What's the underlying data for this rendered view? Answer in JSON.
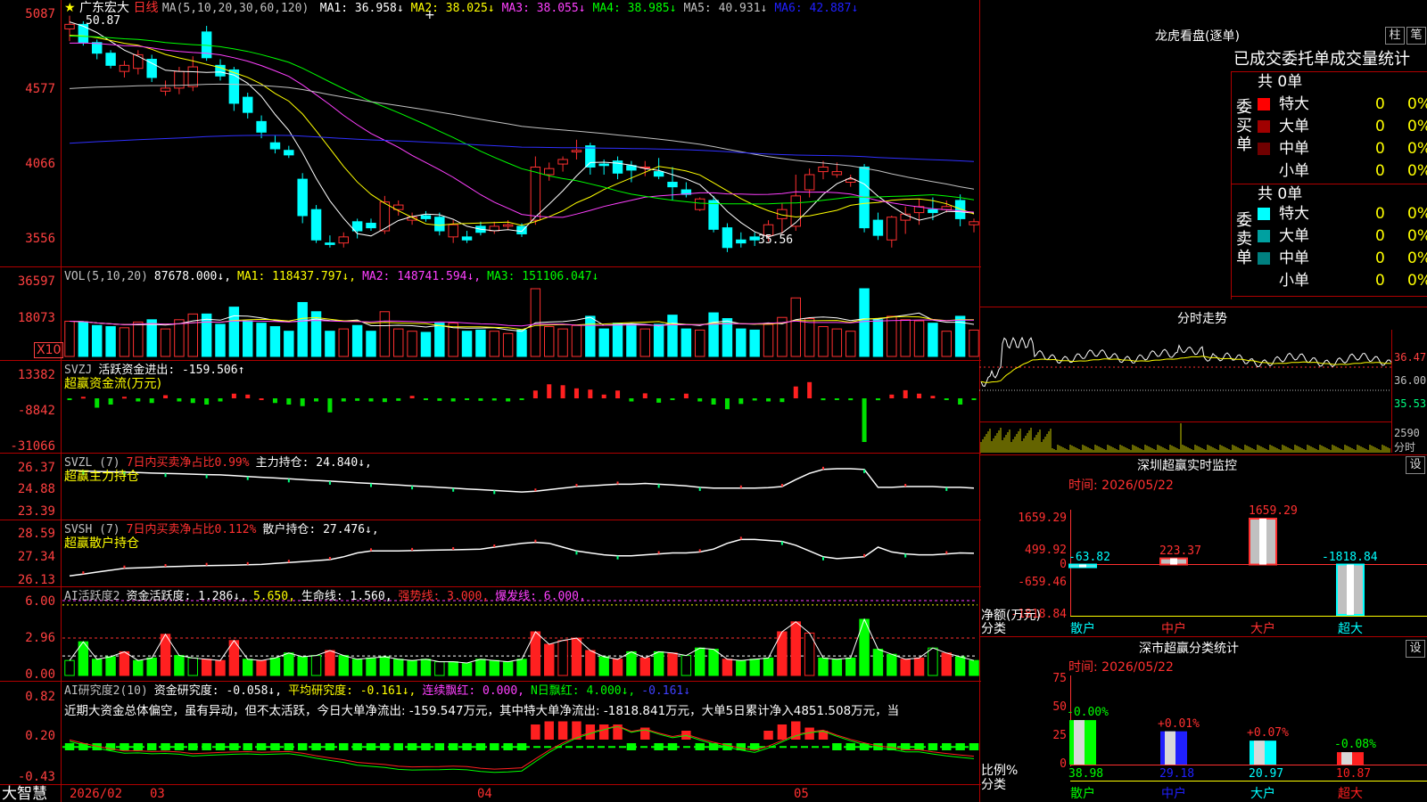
{
  "stock": {
    "star": "★",
    "name": "广东宏大",
    "period": "日线"
  },
  "ma_header": {
    "prefix": "MA(5,10,20,30,60,120)",
    "items": [
      {
        "text": "MA1: 36.958↓",
        "color": "#ffffff"
      },
      {
        "text": "MA2: 38.025↓",
        "color": "#ffff00"
      },
      {
        "text": "MA3: 38.055↓",
        "color": "#ff40ff"
      },
      {
        "text": "MA4: 38.985↓",
        "color": "#00ff00"
      },
      {
        "text": "MA5: 40.931↓",
        "color": "#c0c0c0"
      },
      {
        "text": "MA6: 42.887↓",
        "color": "#2020ff"
      }
    ],
    "high_note": "50.87",
    "low_note": "35.56",
    "cursor": "+"
  },
  "price_axis": [
    "5087",
    "4577",
    "4066",
    "3556"
  ],
  "vol": {
    "header": [
      {
        "text": "VOL(5,10,20)",
        "color": "#c0c0c0"
      },
      {
        "text": "87678.000↓,",
        "color": "#ffffff"
      },
      {
        "text": "MA1: 118437.797↓,",
        "color": "#ffff00"
      },
      {
        "text": "MA2: 148741.594↓,",
        "color": "#ff40ff"
      },
      {
        "text": "MA3: 151106.047↓",
        "color": "#00ff00"
      }
    ],
    "axis": [
      "36597",
      "18073"
    ],
    "unit": "X10"
  },
  "svzj": {
    "header": [
      {
        "text": "SVZJ",
        "color": "#c0c0c0"
      },
      {
        "text": "活跃资金进出: -159.506↑",
        "color": "#ffffff"
      }
    ],
    "sub": "超赢资金流(万元)",
    "axis": [
      "13382",
      "-8842",
      "-31066"
    ]
  },
  "svzl": {
    "header": [
      {
        "text": "SVZL (7)",
        "color": "#c0c0c0"
      },
      {
        "text": "7日内买卖净占比0.99%",
        "color": "#ff3030"
      },
      {
        "text": "主力持仓: 24.840↓,",
        "color": "#ffffff"
      }
    ],
    "sub": "超赢主力持仓",
    "axis": [
      "26.37",
      "24.88",
      "23.39"
    ]
  },
  "svsh": {
    "header": [
      {
        "text": "SVSH (7)",
        "color": "#c0c0c0"
      },
      {
        "text": "7日内买卖净占比0.112%",
        "color": "#ff3030"
      },
      {
        "text": "散户持仓: 27.476↓,",
        "color": "#ffffff"
      }
    ],
    "sub": "超赢散户持仓",
    "axis": [
      "28.59",
      "27.34",
      "26.13"
    ]
  },
  "ai_act": {
    "header": [
      {
        "text": "AI活跃度2",
        "color": "#c0c0c0"
      },
      {
        "text": "资金活跃度: 1.286↓,",
        "color": "#ffffff"
      },
      {
        "text": "5.650,",
        "color": "#ffff00"
      },
      {
        "text": "生命线: 1.560,",
        "color": "#ffffff"
      },
      {
        "text": "强势线: 3.000,",
        "color": "#ff3030"
      },
      {
        "text": "爆发线: 6.000,",
        "color": "#ff40ff"
      }
    ],
    "axis": [
      "6.00",
      "2.96",
      "0.00"
    ]
  },
  "ai_res": {
    "header": [
      {
        "text": "AI研究度2(10)",
        "color": "#c0c0c0"
      },
      {
        "text": "资金研究度: -0.058↓,",
        "color": "#ffffff"
      },
      {
        "text": "平均研究度: -0.161↓,",
        "color": "#ffff00"
      },
      {
        "text": "连续飘红: 0.000,",
        "color": "#ff40ff"
      },
      {
        "text": "N日飘红: 4.000↓,",
        "color": "#00ff00"
      },
      {
        "text": "-0.161↓",
        "color": "#4040ff"
      }
    ],
    "note": "近期大资金总体偏空，虽有异动，但不太活跃，今日大单净流出: -159.547万元，其中特大单净流出: -1818.841万元，大单5日累计净入4851.508万元，当",
    "axis": [
      "0.82",
      "0.20",
      "-0.43"
    ]
  },
  "dates": {
    "brand": "大智慧",
    "first": "2026/02",
    "labels": [
      "03",
      "04",
      "05"
    ]
  },
  "dragon": {
    "title": "龙虎看盘(逐单)",
    "btn_bar": "柱",
    "btn_tick": "笔",
    "tabs": "已成交委托单成交量统计",
    "buy": {
      "side": "委买单",
      "total": "共 0单",
      "rows": [
        {
          "name": "特大",
          "count": "0",
          "pct": "0%",
          "color": "#ff0000"
        },
        {
          "name": "大单",
          "count": "0",
          "pct": "0%",
          "color": "#a00000"
        },
        {
          "name": "中单",
          "count": "0",
          "pct": "0%",
          "color": "#700000"
        },
        {
          "name": "小单",
          "count": "0",
          "pct": "0%",
          "color": "#000000"
        }
      ]
    },
    "sell": {
      "side": "委卖单",
      "total": "共 0单",
      "rows": [
        {
          "name": "特大",
          "count": "0",
          "pct": "0%",
          "color": "#00ffff"
        },
        {
          "name": "大单",
          "count": "0",
          "pct": "0%",
          "color": "#00a0a0"
        },
        {
          "name": "中单",
          "count": "0",
          "pct": "0%",
          "color": "#008080"
        },
        {
          "name": "小单",
          "count": "0",
          "pct": "0%",
          "color": "#000000"
        }
      ]
    }
  },
  "intraday": {
    "title": "分时走势",
    "axis": [
      "36.47",
      "36.00",
      "35.53"
    ],
    "vol_axis": "2590",
    "vol_unit": "分时"
  },
  "monitor": {
    "title": "深圳超赢实时监控",
    "btn": "设",
    "time": "时间: 2026/05/22",
    "axis": [
      "1659.29",
      "499.92",
      "0",
      "-659.46",
      "-1818.84"
    ],
    "side_label": "净额(万元)",
    "side_label2": "分类",
    "categories": [
      "散户",
      "中户",
      "大户",
      "超大"
    ],
    "bar_labels": [
      "-63.82",
      "223.37",
      "1659.29",
      "-1818.84"
    ],
    "values": [
      -63.82,
      223.37,
      1659.29,
      -1818.84
    ]
  },
  "classify": {
    "title": "深市超赢分类统计",
    "btn": "设",
    "time": "时间: 2026/05/22",
    "axis": [
      "75",
      "50",
      "25",
      "0"
    ],
    "side_label": "比例%",
    "side_label2": "分类",
    "categories": [
      "散户",
      "中户",
      "大户",
      "超大"
    ],
    "values": [
      38.98,
      29.18,
      20.97,
      10.87
    ],
    "value_labels": [
      "38.98",
      "29.18",
      "20.97",
      "10.87"
    ],
    "changes": [
      "-0.00%",
      "+0.01%",
      "+0.07%",
      "-0.08%"
    ],
    "colors": [
      "#00ff00",
      "#2020ff",
      "#00ffff",
      "#ff2020"
    ]
  },
  "candles": [
    [
      50.0,
      50.87,
      49.2,
      50.3
    ],
    [
      50.3,
      50.5,
      48.9,
      49.1
    ],
    [
      49.1,
      49.3,
      48.0,
      48.4
    ],
    [
      48.4,
      48.6,
      47.4,
      47.6
    ],
    [
      47.2,
      47.9,
      46.8,
      47.6
    ],
    [
      47.4,
      48.6,
      47.0,
      48.3
    ],
    [
      48.0,
      48.3,
      46.5,
      46.8
    ],
    [
      45.9,
      46.6,
      45.6,
      46.1
    ],
    [
      46.1,
      47.5,
      45.7,
      47.2
    ],
    [
      46.2,
      48.2,
      45.9,
      47.5
    ],
    [
      49.8,
      50.2,
      47.9,
      48.1
    ],
    [
      47.6,
      48.0,
      46.6,
      46.9
    ],
    [
      47.3,
      47.5,
      44.6,
      45.1
    ],
    [
      45.5,
      45.8,
      44.1,
      44.5
    ],
    [
      43.9,
      44.3,
      42.8,
      43.2
    ],
    [
      42.5,
      43.0,
      41.8,
      42.1
    ],
    [
      42.0,
      42.3,
      41.5,
      41.7
    ],
    [
      40.1,
      40.5,
      37.2,
      37.7
    ],
    [
      38.1,
      38.4,
      35.9,
      36.1
    ],
    [
      35.9,
      36.4,
      35.6,
      35.8
    ],
    [
      35.9,
      36.6,
      35.6,
      36.3
    ],
    [
      37.3,
      37.5,
      36.2,
      36.7
    ],
    [
      37.2,
      37.5,
      36.7,
      36.9
    ],
    [
      36.7,
      39.0,
      36.5,
      38.6
    ],
    [
      38.1,
      38.7,
      37.7,
      38.4
    ],
    [
      37.4,
      37.9,
      37.1,
      37.6
    ],
    [
      37.7,
      38.0,
      37.3,
      37.5
    ],
    [
      37.6,
      37.9,
      36.4,
      36.7
    ],
    [
      36.3,
      37.4,
      35.9,
      37.1
    ],
    [
      36.3,
      36.7,
      35.9,
      36.1
    ],
    [
      37.0,
      37.3,
      36.4,
      36.6
    ],
    [
      36.7,
      37.3,
      36.5,
      37.0
    ],
    [
      37.0,
      37.4,
      36.8,
      37.1
    ],
    [
      37.0,
      37.2,
      36.3,
      36.5
    ],
    [
      37.4,
      41.6,
      37.1,
      40.9
    ],
    [
      40.4,
      41.2,
      40.0,
      40.8
    ],
    [
      41.1,
      41.6,
      40.6,
      41.4
    ],
    [
      41.9,
      42.7,
      41.4,
      42.0
    ],
    [
      42.3,
      42.5,
      40.4,
      40.9
    ],
    [
      41.1,
      41.4,
      40.4,
      41.0
    ],
    [
      41.3,
      41.6,
      40.1,
      40.5
    ],
    [
      41.0,
      41.3,
      39.9,
      40.7
    ],
    [
      40.9,
      41.3,
      40.3,
      40.9
    ],
    [
      40.6,
      41.5,
      40.1,
      40.3
    ],
    [
      39.9,
      40.9,
      38.7,
      39.6
    ],
    [
      39.4,
      39.9,
      38.9,
      39.1
    ],
    [
      38.1,
      38.9,
      38.0,
      38.8
    ],
    [
      38.7,
      39.0,
      36.6,
      36.8
    ],
    [
      36.9,
      37.2,
      35.3,
      35.6
    ],
    [
      36.1,
      36.6,
      35.6,
      35.9
    ],
    [
      36.3,
      36.6,
      35.7,
      36.1
    ],
    [
      36.4,
      37.4,
      36.0,
      37.1
    ],
    [
      37.5,
      38.5,
      36.5,
      38.1
    ],
    [
      37.0,
      40.4,
      36.7,
      39.0
    ],
    [
      39.4,
      40.8,
      38.9,
      40.4
    ],
    [
      40.6,
      41.3,
      40.1,
      40.9
    ],
    [
      40.4,
      41.2,
      40.2,
      40.6
    ],
    [
      39.9,
      40.4,
      39.6,
      40.1
    ],
    [
      40.9,
      41.1,
      36.6,
      36.9
    ],
    [
      37.4,
      37.9,
      36.1,
      36.4
    ],
    [
      36.1,
      37.7,
      35.6,
      37.6
    ],
    [
      37.4,
      38.3,
      36.5,
      37.8
    ],
    [
      37.9,
      38.8,
      37.1,
      38.3
    ],
    [
      38.1,
      38.9,
      37.4,
      37.9
    ],
    [
      38.1,
      38.7,
      37.9,
      38.3
    ],
    [
      38.7,
      39.1,
      37.0,
      37.5
    ],
    [
      37.1,
      37.5,
      36.6,
      37.3
    ]
  ],
  "svzj_values": [
    -0.5,
    0.5,
    -3,
    -2,
    0.5,
    -1,
    -1.5,
    1,
    -1,
    -1.5,
    -2,
    -1,
    1.5,
    1.2,
    0,
    -1.5,
    -2,
    -2.5,
    -1,
    -4.5,
    -1,
    -0.8,
    -1,
    -1.2,
    -0.8,
    0.8,
    -0.5,
    -0.8,
    -1,
    -0.5,
    -0.8,
    -0.7,
    -1,
    -0.5,
    2.5,
    4.5,
    4.2,
    3.2,
    2.8,
    1.2,
    2.5,
    -1,
    1.6,
    -1.4,
    -0.5,
    1.5,
    -1,
    -2,
    -3.5,
    -1.8,
    -0.7,
    -1,
    -1.2,
    3.8,
    5.2,
    -0.6,
    -0.4,
    -0.6,
    -14,
    -0.6,
    1.2,
    2.6,
    1.5,
    0.8,
    -0.5,
    -2,
    -0.5
  ],
  "svzl_values": [
    26.1,
    26.05,
    26.02,
    26.0,
    25.98,
    25.95,
    25.92,
    25.9,
    25.88,
    25.85,
    25.82,
    25.8,
    25.75,
    25.7,
    25.65,
    25.6,
    25.55,
    25.5,
    25.45,
    25.4,
    25.35,
    25.3,
    25.25,
    25.2,
    25.15,
    25.1,
    25.05,
    25.0,
    24.95,
    24.9,
    24.85,
    24.8,
    24.75,
    24.7,
    24.75,
    24.85,
    24.95,
    25.05,
    25.1,
    25.15,
    25.2,
    25.2,
    25.25,
    25.2,
    25.15,
    25.1,
    25.0,
    24.95,
    24.95,
    24.95,
    24.95,
    24.98,
    25.05,
    25.5,
    25.9,
    26.15,
    26.2,
    26.2,
    26.15,
    25.0,
    25.0,
    25.05,
    25.05,
    25.05,
    25.0,
    25.0,
    24.95
  ],
  "svsh_values": [
    26.3,
    26.4,
    26.5,
    26.6,
    26.7,
    26.72,
    26.75,
    26.78,
    26.8,
    26.82,
    26.84,
    26.85,
    26.86,
    26.88,
    26.9,
    26.95,
    27.0,
    27.05,
    27.1,
    27.15,
    27.3,
    27.5,
    27.6,
    27.6,
    27.6,
    27.62,
    27.64,
    27.65,
    27.66,
    27.68,
    27.7,
    27.8,
    27.9,
    28.0,
    28.05,
    28.0,
    27.8,
    27.6,
    27.5,
    27.4,
    27.35,
    27.35,
    27.4,
    27.45,
    27.5,
    27.5,
    27.55,
    27.7,
    28.0,
    28.2,
    28.2,
    28.15,
    28.1,
    27.9,
    27.6,
    27.3,
    27.2,
    27.25,
    27.3,
    27.8,
    27.55,
    27.45,
    27.4,
    27.4,
    27.45,
    27.5,
    27.48
  ],
  "ai_act_values": [
    1.2,
    2.7,
    1.3,
    1.5,
    1.9,
    1.2,
    1.4,
    3.3,
    1.6,
    1.4,
    1.3,
    1.2,
    2.8,
    1.3,
    1.2,
    1.4,
    1.8,
    1.5,
    1.6,
    2.0,
    1.6,
    1.3,
    1.4,
    1.5,
    1.3,
    1.2,
    1.3,
    1.1,
    1.1,
    1.0,
    1.3,
    1.2,
    1.1,
    1.3,
    3.5,
    2.5,
    2.8,
    3.0,
    2.0,
    1.5,
    1.3,
    1.9,
    1.4,
    1.9,
    1.8,
    1.6,
    2.2,
    2.1,
    1.3,
    1.2,
    1.3,
    1.4,
    3.5,
    4.3,
    3.4,
    1.4,
    1.3,
    1.4,
    4.5,
    2.1,
    1.7,
    1.3,
    1.4,
    2.2,
    1.8,
    1.5,
    1.2
  ],
  "ai_red_days": [
    4,
    7,
    10,
    11,
    12,
    14,
    19,
    34,
    35,
    36,
    37,
    38,
    40,
    42,
    44,
    48,
    52,
    53,
    54,
    61,
    62,
    64
  ],
  "ai_res_values": [
    -0.2,
    -0.2,
    -0.2,
    -0.2,
    -0.2,
    -0.1,
    -0.15,
    -0.1,
    -0.15,
    -0.2,
    -0.1,
    -0.1,
    -0.1,
    -0.1,
    -0.15,
    -0.1,
    -0.1,
    -0.2,
    -0.25,
    -0.25,
    -0.25,
    -0.3,
    -0.25,
    -0.25,
    -0.3,
    -0.25,
    -0.22,
    -0.22,
    -0.2,
    -0.25,
    -0.3,
    -0.28,
    -0.22,
    -0.2,
    0.2,
    0.25,
    0.25,
    0.25,
    0.2,
    0.2,
    0.2,
    -0.2,
    0.15,
    -0.15,
    -0.15,
    0.1,
    -0.2,
    -0.2,
    -0.2,
    -0.2,
    -0.2,
    0.1,
    0.2,
    0.25,
    0.15,
    0.1,
    -0.2,
    -0.2,
    -0.2,
    -0.2,
    -0.15,
    -0.2,
    -0.1,
    -0.2,
    -0.2,
    -0.2,
    -0.2
  ]
}
